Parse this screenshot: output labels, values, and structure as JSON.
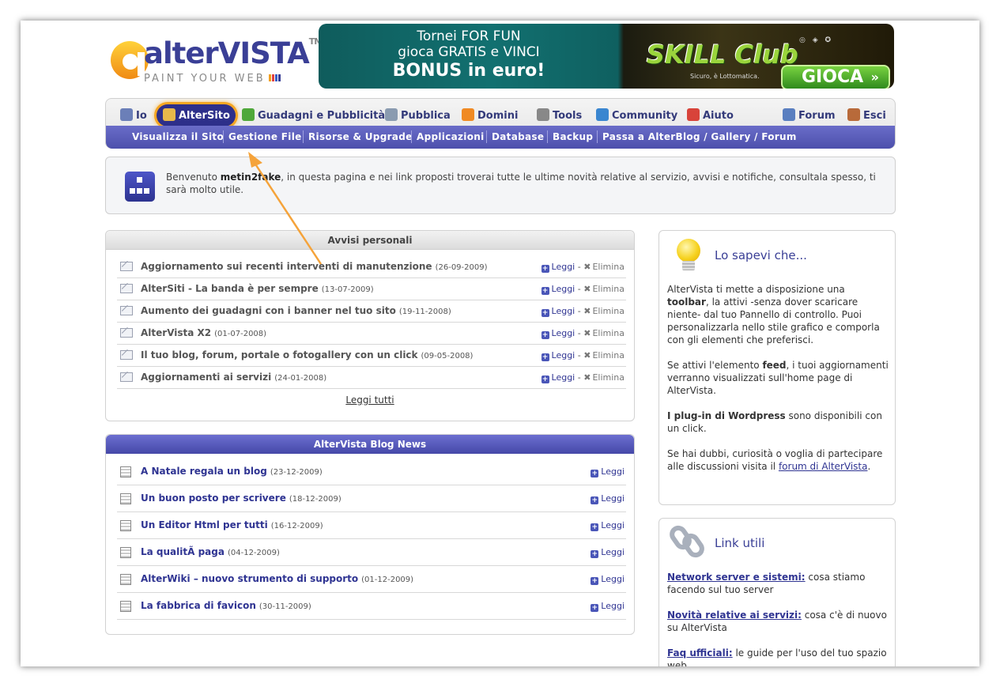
{
  "logo": {
    "brand": "alterVISTA",
    "tm": "TM",
    "tagline": "PAINT YOUR WEB"
  },
  "banner": {
    "line1": "Tornei FOR FUN",
    "line2": "gioca GRATIS  e VINCI",
    "line3": "BONUS in euro!",
    "brand": "SKILL Club",
    "subtitle": "Sicuro, è Lottomatica.",
    "button": "GIOCA"
  },
  "nav": {
    "items": [
      {
        "label": "Io",
        "icon": "user-icon",
        "color": "#6b7fb8"
      },
      {
        "label": "AlterSito",
        "icon": "house-icon",
        "color": "#e7b84a"
      },
      {
        "label": "Guadagni e Pubblicità",
        "icon": "dollar-icon",
        "color": "#4fa83a"
      },
      {
        "label": "Pubblica",
        "icon": "publish-icon",
        "color": "#8a9bb0"
      },
      {
        "label": "Domini",
        "icon": "www-icon",
        "color": "#f08a24"
      },
      {
        "label": "Tools",
        "icon": "tools-icon",
        "color": "#888888"
      },
      {
        "label": "Community",
        "icon": "globe-icon",
        "color": "#3a86d0"
      },
      {
        "label": "Aiuto",
        "icon": "lifebuoy-icon",
        "color": "#d8433a"
      },
      {
        "label": "Forum",
        "icon": "forum-icon",
        "color": "#5a7fc0"
      },
      {
        "label": "Esci",
        "icon": "exit-icon",
        "color": "#b86a3a"
      }
    ],
    "sub": [
      "Visualizza il Sito",
      "Gestione File",
      "Risorse & Upgrade",
      "Applicazioni",
      "Database",
      "Backup",
      "Passa a AlterBlog / Gallery / Forum"
    ]
  },
  "welcome": {
    "pre": "Benvenuto ",
    "user": "metin2fake",
    "post": ", in questa pagina e nei link proposti troverai tutte le ultime novità relative al servizio, avvisi e notifiche, consultala spesso, ti sarà molto utile."
  },
  "avvisi": {
    "title": "Avvisi personali",
    "read": "Leggi",
    "sep": "-",
    "delete": "Elimina",
    "read_all": "Leggi tutti",
    "items": [
      {
        "title": "Aggiornamento sui recenti interventi di manutenzione",
        "date": "(26-09-2009)"
      },
      {
        "title": "AlterSiti - La banda è per sempre",
        "date": "(13-07-2009)"
      },
      {
        "title": "Aumento dei guadagni con i banner nel tuo sito",
        "date": "(19-11-2008)"
      },
      {
        "title": "AlterVista X2",
        "date": "(01-07-2008)"
      },
      {
        "title": "Il tuo blog, forum, portale o fotogallery con un click",
        "date": "(09-05-2008)"
      },
      {
        "title": "Aggiornamenti ai servizi",
        "date": "(24-01-2008)"
      }
    ]
  },
  "blog": {
    "title": "AlterVista Blog News",
    "read": "Leggi",
    "items": [
      {
        "title": "A Natale regala un blog",
        "date": "(23-12-2009)"
      },
      {
        "title": "Un buon posto per scrivere",
        "date": "(18-12-2009)"
      },
      {
        "title": "Un Editor Html per tutti",
        "date": "(16-12-2009)"
      },
      {
        "title": "La qualitÃ  paga",
        "date": "(04-12-2009)"
      },
      {
        "title": "AlterWiki – nuovo strumento di supporto",
        "date": "(01-12-2009)"
      },
      {
        "title": "La fabbrica di favicon",
        "date": "(30-11-2009)"
      }
    ]
  },
  "sapevi": {
    "title": "Lo sapevi che...",
    "p1a": "AlterVista ti mette a disposizione una ",
    "p1b": "toolbar",
    "p1c": ", la attivi -senza dover scaricare niente- dal tuo Pannello di controllo. Puoi personalizzarla nello stile grafico e comporla con gli elementi che preferisci.",
    "p2a": "Se attivi l'elemento ",
    "p2b": "feed",
    "p2c": ", i tuoi aggiornamenti verranno visualizzati sull'home page di AlterVista.",
    "p3a": "I plug-in di Wordpress",
    "p3b": " sono disponibili con un click.",
    "p4a": "Se hai dubbi, curiosità o voglia di partecipare alle discussioni visita il ",
    "p4link": "forum di AlterVista",
    "p4b": "."
  },
  "links": {
    "title": "Link utili",
    "items": [
      {
        "label": "Network server e sistemi:",
        "text": " cosa stiamo facendo sul tuo server"
      },
      {
        "label": "Novità relative ai servizi:",
        "text": " cosa c'è di nuovo su AlterVista"
      },
      {
        "label": "Faq ufficiali:",
        "text": " le guide per l'uso del tuo spazio web"
      }
    ]
  },
  "colors": {
    "brand": "#3a3f96",
    "highlight": "#f5a623",
    "subnav": "#5557b8"
  }
}
